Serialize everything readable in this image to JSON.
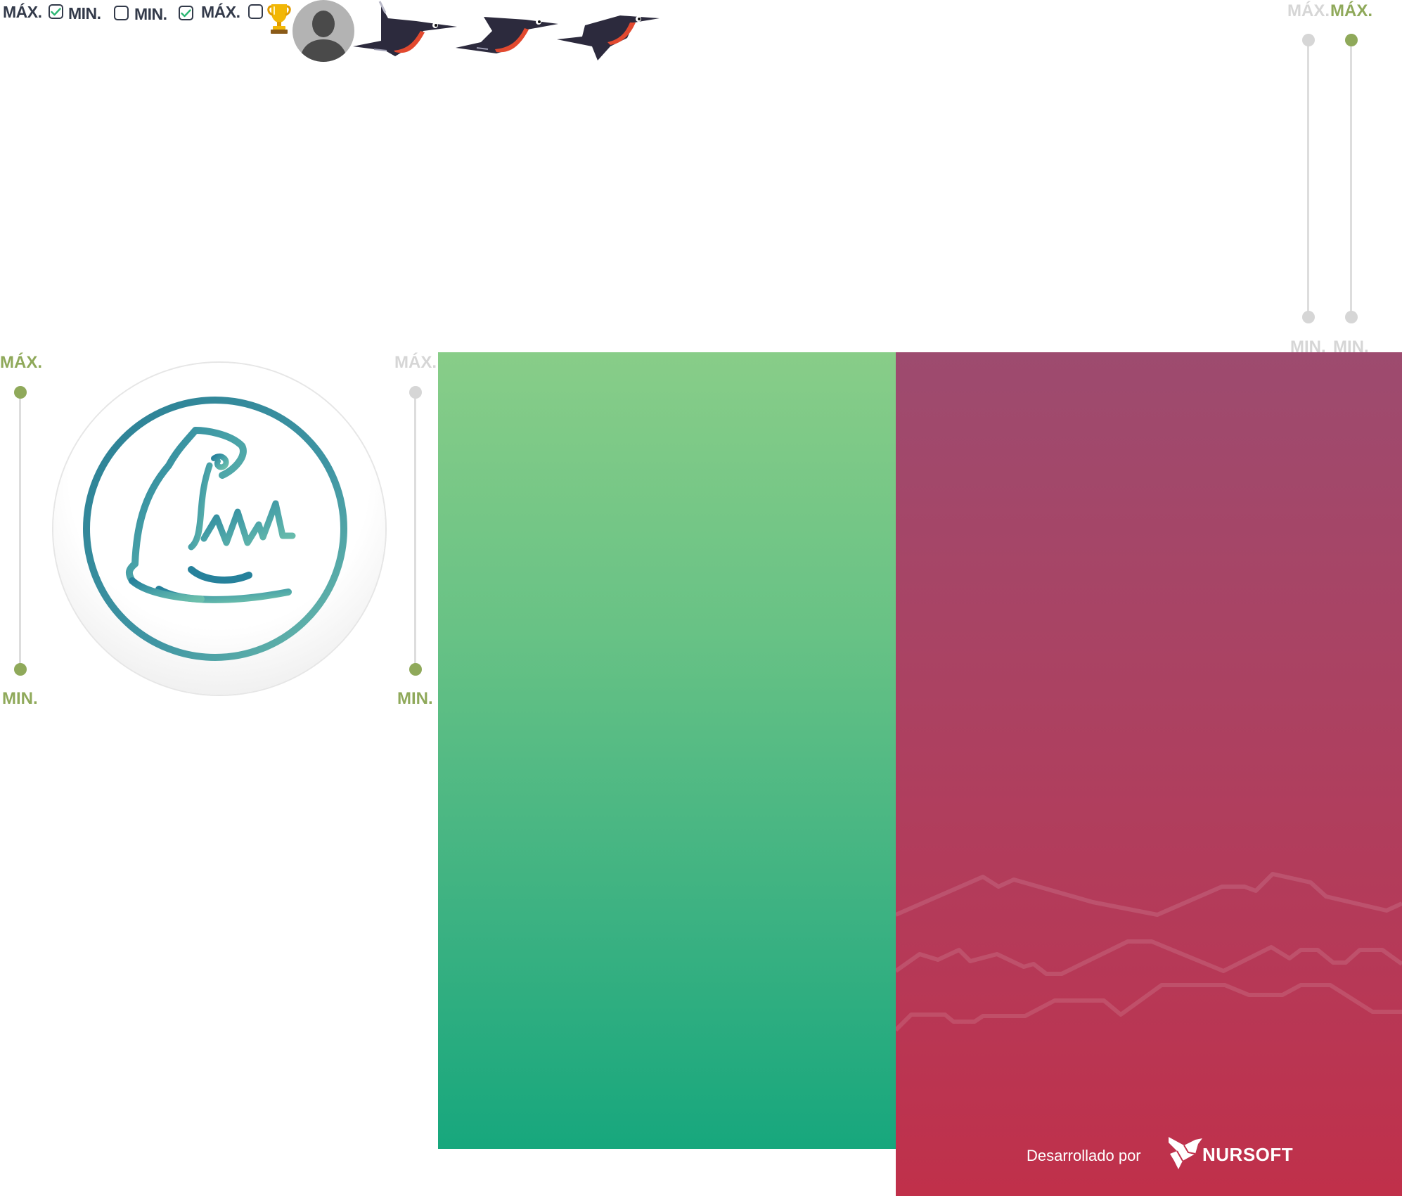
{
  "legend_row": {
    "items": [
      {
        "label": "MÁX.",
        "checked": true
      },
      {
        "label": "MIN.",
        "checked": false
      },
      {
        "label": "MIN.",
        "checked": true
      },
      {
        "label": "MÁX.",
        "checked": false
      }
    ]
  },
  "icons": {
    "trophy": "trophy-icon",
    "avatar": "user-avatar-placeholder",
    "birds": [
      "bird-flying-1",
      "bird-flying-2",
      "bird-flying-3"
    ],
    "app_logo": "wizard-hat-logo"
  },
  "sliders": {
    "top_right_inactive": {
      "max_label": "MÁX.",
      "min_label": "MIN."
    },
    "top_right_active": {
      "max_label": "MÁX.",
      "min_label": "MIN."
    },
    "left_active": {
      "max_label": "MÁX.",
      "min_label": "MIN."
    },
    "mid_mixed": {
      "max_label": "MÁX.",
      "min_label": "MIN."
    }
  },
  "footer": {
    "developed_by": "Desarrollado por",
    "brand": "NURSOFT"
  },
  "colors": {
    "accent_green": "#8fa95a",
    "inactive_grey": "#d6d6d6",
    "text_dark": "#333a4a",
    "panel_green_top": "#88cd88",
    "panel_green_bottom": "#17a77d",
    "panel_red_top": "#9d4b6f",
    "panel_red_bottom": "#c0304a",
    "logo_teal": "#2a7f94"
  }
}
